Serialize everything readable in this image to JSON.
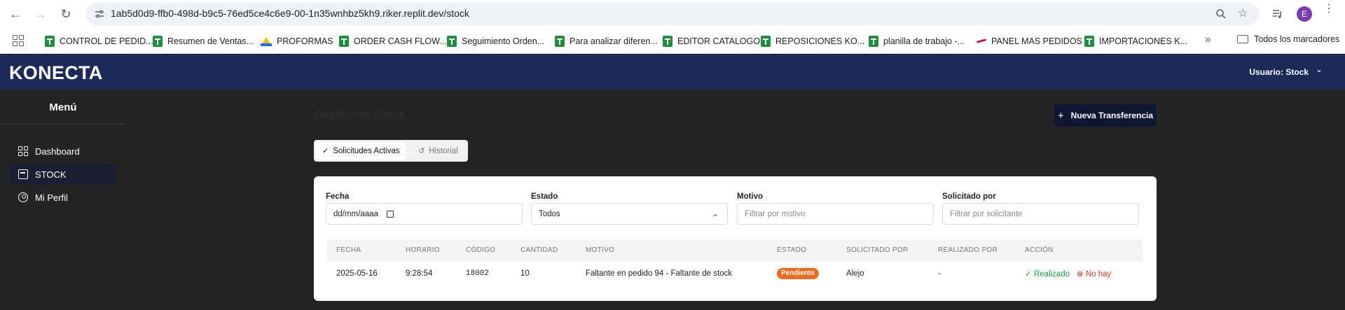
{
  "browser": {
    "url": "1ab5d0d9-ffb0-498d-b9c5-76ed5ce4c6e9-00-1n35wnhbz5kh9.riker.replit.dev/stock",
    "profile_initial": "E",
    "bookmarks": [
      {
        "label": "CONTROL DE PEDID...",
        "icon": "sheets-icon"
      },
      {
        "label": "Resumen de Ventas...",
        "icon": "sheets-icon"
      },
      {
        "label": "PROFORMAS",
        "icon": "drive-icon"
      },
      {
        "label": "ORDER CASH FLOW...",
        "icon": "sheets-icon"
      },
      {
        "label": "Seguimiento Orden...",
        "icon": "sheets-icon"
      },
      {
        "label": "Para analizar diferen...",
        "icon": "sheets-icon"
      },
      {
        "label": "EDITOR CATALOGO",
        "icon": "sheets-icon"
      },
      {
        "label": "REPOSICIONES KO...",
        "icon": "sheets-icon"
      },
      {
        "label": "planilla de trabajo -...",
        "icon": "sheets-icon"
      },
      {
        "label": "PANEL MAS PEDIDOS",
        "icon": "app-icon"
      },
      {
        "label": "IMPORTACIONES K...",
        "icon": "sheets-icon"
      }
    ],
    "all_bookmarks": "Todos los marcadores"
  },
  "header": {
    "brand": "KONECTA",
    "user": "Usuario: Stock"
  },
  "sidebar": {
    "title": "Menú",
    "items": [
      {
        "label": "Dashboard",
        "icon": "dashboard-icon"
      },
      {
        "label": "STOCK",
        "icon": "package-icon"
      },
      {
        "label": "Mi Perfil",
        "icon": "user-circle-icon"
      }
    ]
  },
  "main": {
    "title": "Gestión de Stock",
    "new_button": "Nueva Transferencia",
    "tabs": [
      {
        "label": "Solicitudes Activas",
        "icon": "check-icon"
      },
      {
        "label": "Historial",
        "icon": "history-icon"
      }
    ],
    "filters": {
      "fecha": {
        "label": "Fecha",
        "value": "dd/mm/aaaa"
      },
      "estado": {
        "label": "Estado",
        "value": "Todos"
      },
      "motivo": {
        "label": "Motivo",
        "placeholder": "Filtrar por motivo"
      },
      "solicitado": {
        "label": "Solicitado por",
        "placeholder": "Filtrar por solicitante"
      }
    },
    "table": {
      "columns": [
        "FECHA",
        "HORARIO",
        "CÓDIGO",
        "CANTIDAD",
        "MOTIVO",
        "ESTADO",
        "SOLICITADO POR",
        "REALIZADO POR",
        "ACCIÓN"
      ],
      "rows": [
        {
          "fecha": "2025-05-16",
          "horario": "9:28:54",
          "codigo": "18002",
          "cantidad": "10",
          "motivo": "Faltante en pedido 94 - Faltante de stock",
          "estado": "Pendiente",
          "solicitado": "Alejo",
          "realizado": "-",
          "accion_ok": "Realizado",
          "accion_no": "No hay"
        }
      ]
    }
  }
}
